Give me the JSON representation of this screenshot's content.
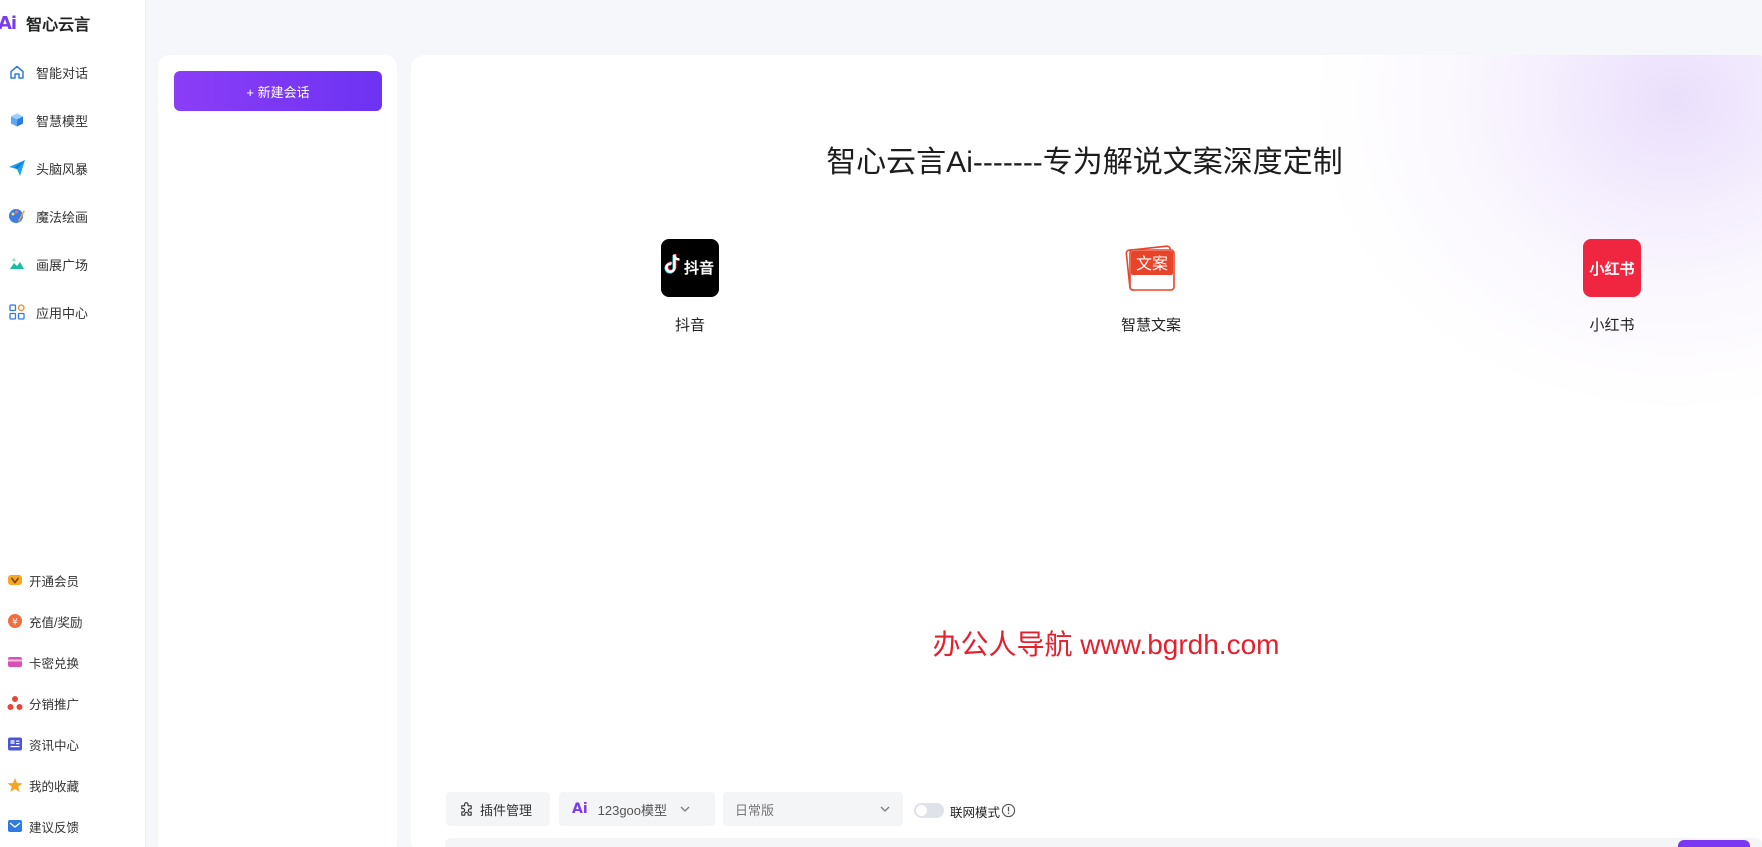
{
  "brand": {
    "logo": "Ai",
    "name": "智心云言"
  },
  "nav": [
    {
      "label": "智能对话",
      "icon": "home-icon"
    },
    {
      "label": "智慧模型",
      "icon": "cube-icon"
    },
    {
      "label": "头脑风暴",
      "icon": "paper-plane-icon"
    },
    {
      "label": "魔法绘画",
      "icon": "palette-icon"
    },
    {
      "label": "画展广场",
      "icon": "image-icon"
    },
    {
      "label": "应用中心",
      "icon": "apps-grid-icon"
    }
  ],
  "bottom_nav": [
    {
      "label": "开通会员",
      "icon": "vip-icon"
    },
    {
      "label": "充值/奖励",
      "icon": "coin-icon"
    },
    {
      "label": "卡密兑换",
      "icon": "card-icon"
    },
    {
      "label": "分销推广",
      "icon": "network-icon"
    },
    {
      "label": "资讯中心",
      "icon": "news-icon"
    },
    {
      "label": "我的收藏",
      "icon": "star-icon"
    },
    {
      "label": "建议反馈",
      "icon": "feedback-icon"
    }
  ],
  "session": {
    "new_chat_label": "+ 新建会话"
  },
  "main": {
    "title": "智心云言Ai-------专为解说文案深度定制",
    "apps": [
      {
        "label": "抖音",
        "tile_text": "抖音",
        "icon": "douyin-logo"
      },
      {
        "label": "智慧文案",
        "tile_text": "文案",
        "icon": "wenan-logo"
      },
      {
        "label": "小红书",
        "tile_text": "小红书",
        "icon": "xiaohongshu-logo"
      }
    ],
    "watermark": "办公人导航 www.bgrdh.com"
  },
  "toolbar": {
    "plugin_label": "插件管理",
    "model_logo": "Ai",
    "model_label": "123goo模型",
    "version_label": "日常版",
    "web_mode_label": "联网模式",
    "web_mode_on": false
  },
  "colors": {
    "accent": "#7a38f2",
    "watermark": "#e5202e",
    "douyin": "#000000",
    "xiaohongshu": "#f0253f",
    "wenan": "#e8442a"
  }
}
